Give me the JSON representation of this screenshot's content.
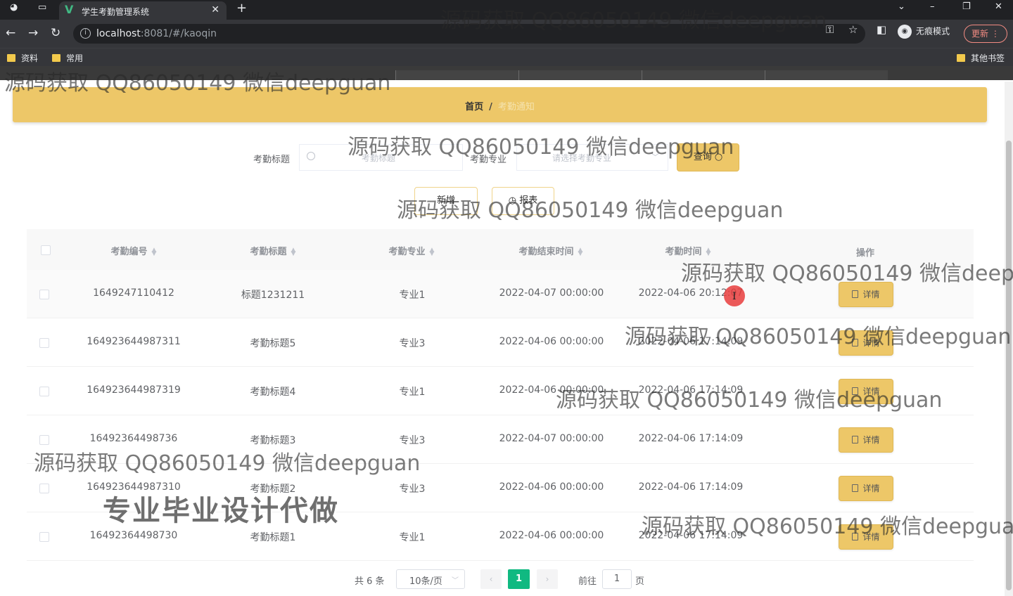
{
  "browser": {
    "tab_title": "学生考勤管理系统",
    "url_host": "localhost",
    "url_rest": ":8081/#/kaoqin",
    "incognito_label": "无痕模式",
    "update_label": "更新",
    "bookmarks": [
      "资料",
      "常用"
    ],
    "other_bookmarks": "其他书签"
  },
  "breadcrumb": {
    "home": "首页",
    "separator": "/",
    "current": "考勤通知"
  },
  "search": {
    "title_label": "考勤标题",
    "title_placeholder": "考勤标题",
    "major_label": "考勤专业",
    "major_placeholder": "请选择考勤专业",
    "query_button": "查询"
  },
  "actions": {
    "add_button": "新增",
    "report_button": "报表"
  },
  "table": {
    "columns": [
      "考勤编号",
      "考勤标题",
      "考勤专业",
      "考勤结束时间",
      "考勤时间",
      "操作"
    ],
    "detail_label": "详情",
    "rows": [
      {
        "id": "1649247110412",
        "title": "标题1231211",
        "major": "专业1",
        "end_time": "2022-04-07 00:00:00",
        "time": "2022-04-06 20:12:07"
      },
      {
        "id": "164923644987311",
        "title": "考勤标题5",
        "major": "专业3",
        "end_time": "2022-04-06 00:00:00",
        "time": "2022-04-06 17:14:09"
      },
      {
        "id": "164923644987319",
        "title": "考勤标题4",
        "major": "专业1",
        "end_time": "2022-04-06 00:00:00",
        "time": "2022-04-06 17:14:09"
      },
      {
        "id": "16492364498736",
        "title": "考勤标题3",
        "major": "专业3",
        "end_time": "2022-04-07 00:00:00",
        "time": "2022-04-06 17:14:09"
      },
      {
        "id": "164923644987310",
        "title": "考勤标题2",
        "major": "专业3",
        "end_time": "2022-04-06 00:00:00",
        "time": "2022-04-06 17:14:09"
      },
      {
        "id": "16492364498730",
        "title": "考勤标题1",
        "major": "专业1",
        "end_time": "2022-04-06 00:00:00",
        "time": "2022-04-06 17:14:09"
      }
    ]
  },
  "pagination": {
    "total": "共 6 条",
    "page_size": "10条/页",
    "current_page": "1",
    "goto_label": "前往",
    "goto_value": "1",
    "page_suffix": "页"
  },
  "watermarks": {
    "line": "源码获取 QQ86050149 微信deepguan",
    "big": "专业毕业设计代做"
  },
  "colors": {
    "accent": "#edc768",
    "pager_active": "#10b981"
  }
}
